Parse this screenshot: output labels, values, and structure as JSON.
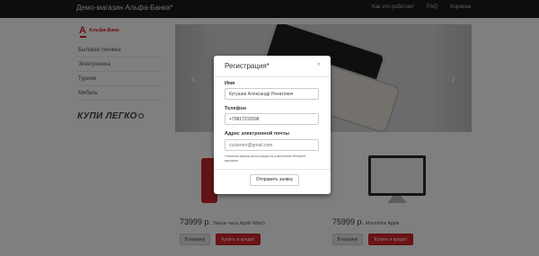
{
  "navbar": {
    "brand": "Демо-магазин Альфа-Банка*",
    "links": [
      "Как это работает",
      "FAQ",
      "Корзина"
    ]
  },
  "logo": {
    "mark": "А",
    "text": "Альфа-Банк"
  },
  "categories": [
    "Бытовая техника",
    "Электроника",
    "Туризм",
    "Мебель"
  ],
  "kupi_logo": "КУПИ ЛЕГКО",
  "carousel": {
    "prev_icon": "‹",
    "next_icon": "›"
  },
  "products": [
    {
      "price": "73999 р.",
      "name": "Умные часы Apple Watch",
      "cart_label": "В корзину",
      "credit_label": "Купить в кредит"
    },
    {
      "price": "75999 р.",
      "name": "Моноблок Apple",
      "cart_label": "В корзину",
      "credit_label": "Купить в кредит"
    }
  ],
  "modal": {
    "title": "Регистрация*",
    "close": "×",
    "name_label": "Имя",
    "name_value": "Кугушев Александр Ренатович",
    "phone_label": "Телефон",
    "phone_value": "+79817215598",
    "email_label": "Адрес электронной почты",
    "email_placeholder": "customer@gmail.com",
    "note": "*Наличие формы регистрации на усмотрение Интернет-магазина",
    "submit_label": "Отправить заявку"
  },
  "colors": {
    "brand_red": "#d9262c",
    "navbar": "#1a1a1a"
  }
}
